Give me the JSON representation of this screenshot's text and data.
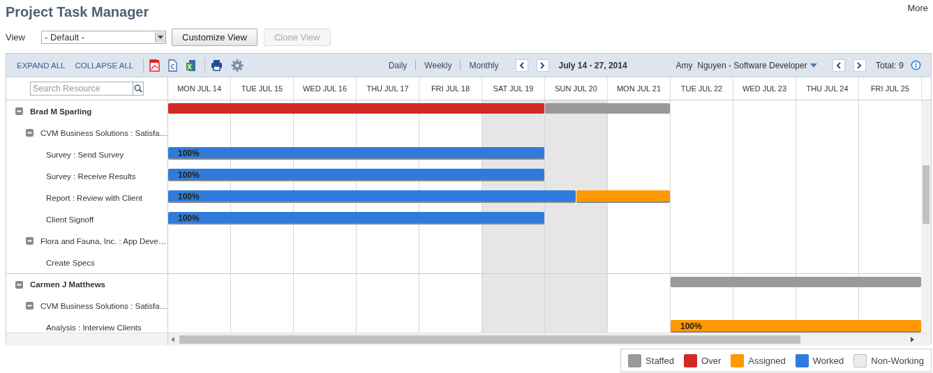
{
  "title": "Project Task Manager",
  "more_link": "More",
  "view": {
    "label": "View",
    "value": "- Default -"
  },
  "buttons": [
    {
      "label": "Customize View",
      "disabled": false
    },
    {
      "label": "Clone View",
      "disabled": true
    }
  ],
  "toolbar": {
    "expand_all": "EXPAND ALL",
    "collapse_all": "COLLAPSE ALL",
    "scales": [
      "Daily",
      "Weekly",
      "Monthly"
    ],
    "date_range": "July 14 - 27, 2014",
    "person": "Amy  Nguyen - Software Developer",
    "total": "Total: 9"
  },
  "search": {
    "placeholder": "Search Resource"
  },
  "days": [
    {
      "label": "MON JUL 14",
      "non_working": false
    },
    {
      "label": "TUE JUL 15",
      "non_working": false
    },
    {
      "label": "WED JUL 16",
      "non_working": false
    },
    {
      "label": "THU JUL 17",
      "non_working": false
    },
    {
      "label": "FRI JUL 18",
      "non_working": false
    },
    {
      "label": "SAT JUL 19",
      "non_working": true
    },
    {
      "label": "SUN JUL 20",
      "non_working": true
    },
    {
      "label": "MON JUL 21",
      "non_working": false
    },
    {
      "label": "TUE JUL 22",
      "non_working": false
    },
    {
      "label": "WED JUL 23",
      "non_working": false
    },
    {
      "label": "THU JUL 24",
      "non_working": false
    },
    {
      "label": "FRI JUL 25",
      "non_working": false
    }
  ],
  "resources": [
    {
      "name": "Brad M Sparling",
      "expanded": true,
      "days": [
        {
          "kind": "over"
        },
        {
          "kind": "over"
        },
        {
          "kind": "over"
        },
        {
          "kind": "over"
        },
        {
          "kind": "over"
        },
        {
          "kind": "over"
        },
        {
          "kind": "staffed"
        },
        {
          "kind": "staffed"
        }
      ],
      "children": [
        {
          "name": "CVM Business Solutions : Satisfa…",
          "expanded": true,
          "children": [
            {
              "name": "Survey : Send Survey",
              "bar_label": "100%",
              "days": [
                {
                  "kind": "worked"
                },
                {
                  "kind": "worked"
                },
                {
                  "kind": "worked"
                },
                {
                  "kind": "worked"
                },
                {
                  "kind": "worked"
                },
                {
                  "kind": "worked"
                }
              ]
            },
            {
              "name": "Survey : Receive Results",
              "bar_label": "100%",
              "days": [
                {
                  "kind": "worked"
                },
                {
                  "kind": "worked"
                },
                {
                  "kind": "worked"
                },
                {
                  "kind": "worked"
                },
                {
                  "kind": "worked"
                },
                {
                  "kind": "worked"
                }
              ]
            },
            {
              "name": "Report : Review with Client",
              "bar_label": "100%",
              "days": [
                {
                  "kind": "worked"
                },
                {
                  "kind": "worked"
                },
                {
                  "kind": "worked"
                },
                {
                  "kind": "worked"
                },
                {
                  "kind": "worked"
                },
                {
                  "kind": "worked"
                },
                {
                  "kind": "split",
                  "parts": [
                    {
                      "kind": "worked"
                    },
                    {
                      "kind": "assigned"
                    }
                  ]
                },
                {
                  "kind": "assigned"
                }
              ]
            },
            {
              "name": "Client Signoff",
              "bar_label": "100%",
              "days": [
                {
                  "kind": "worked"
                },
                {
                  "kind": "worked"
                },
                {
                  "kind": "worked"
                },
                {
                  "kind": "worked"
                },
                {
                  "kind": "worked"
                },
                {
                  "kind": "worked"
                }
              ]
            }
          ]
        },
        {
          "name": "Flora and Fauna, Inc. : App Deve…",
          "expanded": true,
          "children": [
            {
              "name": "Create Specs"
            }
          ]
        }
      ]
    },
    {
      "name": "Carmen J Matthews",
      "expanded": true,
      "days": [
        {
          "kind": "none"
        },
        {
          "kind": "none"
        },
        {
          "kind": "none"
        },
        {
          "kind": "none"
        },
        {
          "kind": "none"
        },
        {
          "kind": "none"
        },
        {
          "kind": "none"
        },
        {
          "kind": "none"
        },
        {
          "kind": "staffed"
        },
        {
          "kind": "staffed"
        },
        {
          "kind": "staffed"
        },
        {
          "kind": "staffed"
        }
      ],
      "children": [
        {
          "name": "CVM Business Solutions : Satisfa…",
          "expanded": true,
          "children": [
            {
              "name": "Analysis : Interview Clients",
              "bar_label": "100%",
              "days": [
                {
                  "kind": "none"
                },
                {
                  "kind": "none"
                },
                {
                  "kind": "none"
                },
                {
                  "kind": "none"
                },
                {
                  "kind": "none"
                },
                {
                  "kind": "none"
                },
                {
                  "kind": "none"
                },
                {
                  "kind": "none"
                },
                {
                  "kind": "assigned"
                },
                {
                  "kind": "assigned"
                },
                {
                  "kind": "assigned"
                },
                {
                  "kind": "assigned"
                }
              ]
            }
          ]
        }
      ]
    }
  ],
  "legend": [
    {
      "kind": "staffed",
      "label": "Staffed",
      "color": "#999999"
    },
    {
      "kind": "over",
      "label": "Over",
      "color": "#d12a26"
    },
    {
      "kind": "assigned",
      "label": "Assigned",
      "color": "#ff9900"
    },
    {
      "kind": "worked",
      "label": "Worked",
      "color": "#2e7bdc"
    },
    {
      "kind": "non_working",
      "label": "Non-Working",
      "color": "#ececec"
    }
  ]
}
